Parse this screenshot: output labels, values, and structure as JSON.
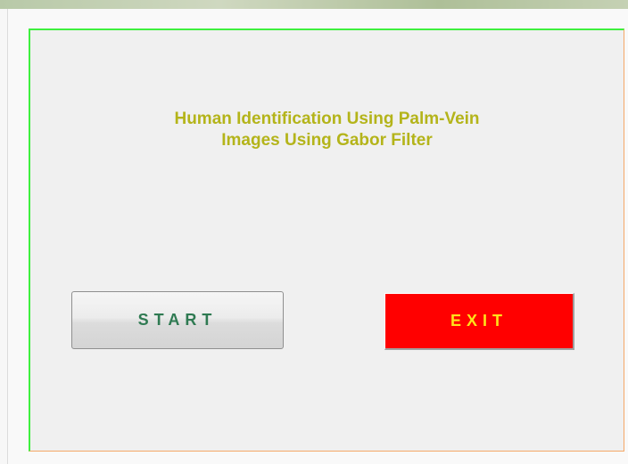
{
  "app": {
    "title_line1": "Human Identification Using Palm-Vein",
    "title_line2": "Images Using Gabor Filter"
  },
  "buttons": {
    "start_label": "START",
    "exit_label": "EXIT"
  },
  "colors": {
    "title_text": "#b4b41a",
    "start_text": "#2f7a52",
    "exit_background": "#ff0000",
    "exit_text": "#ffe21a",
    "panel_border_green": "#3ef03e",
    "panel_border_orange": "#f5a868"
  }
}
